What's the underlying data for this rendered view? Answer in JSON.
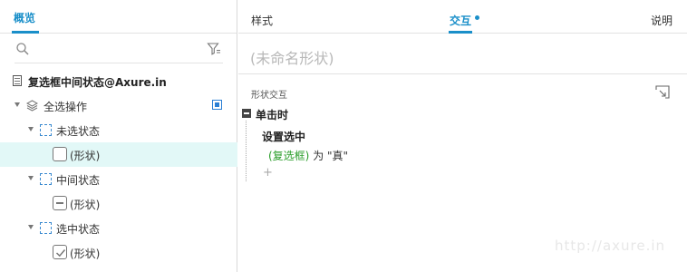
{
  "left_panel": {
    "tab": "概览",
    "tree": [
      {
        "label": "复选框中间状态@Axure.in"
      },
      {
        "label": "全选操作"
      },
      {
        "label": "未选状态"
      },
      {
        "label": "(形状)"
      },
      {
        "label": "中间状态"
      },
      {
        "label": "(形状)"
      },
      {
        "label": "选中状态"
      },
      {
        "label": "(形状)"
      }
    ]
  },
  "right_panel": {
    "tabs": [
      "样式",
      "交互",
      "说明"
    ],
    "name_placeholder": "(未命名形状)",
    "section_label": "形状交互",
    "event": "单击时",
    "action": "设置选中",
    "action_target": "(复选框)",
    "action_rest": " 为 \"真\"",
    "add": "+"
  },
  "watermark": "http://axure.in",
  "colors": {
    "accent": "#1a8fc9",
    "selected_row": "#e2f8f7",
    "target_text": "#2a9d2a"
  }
}
